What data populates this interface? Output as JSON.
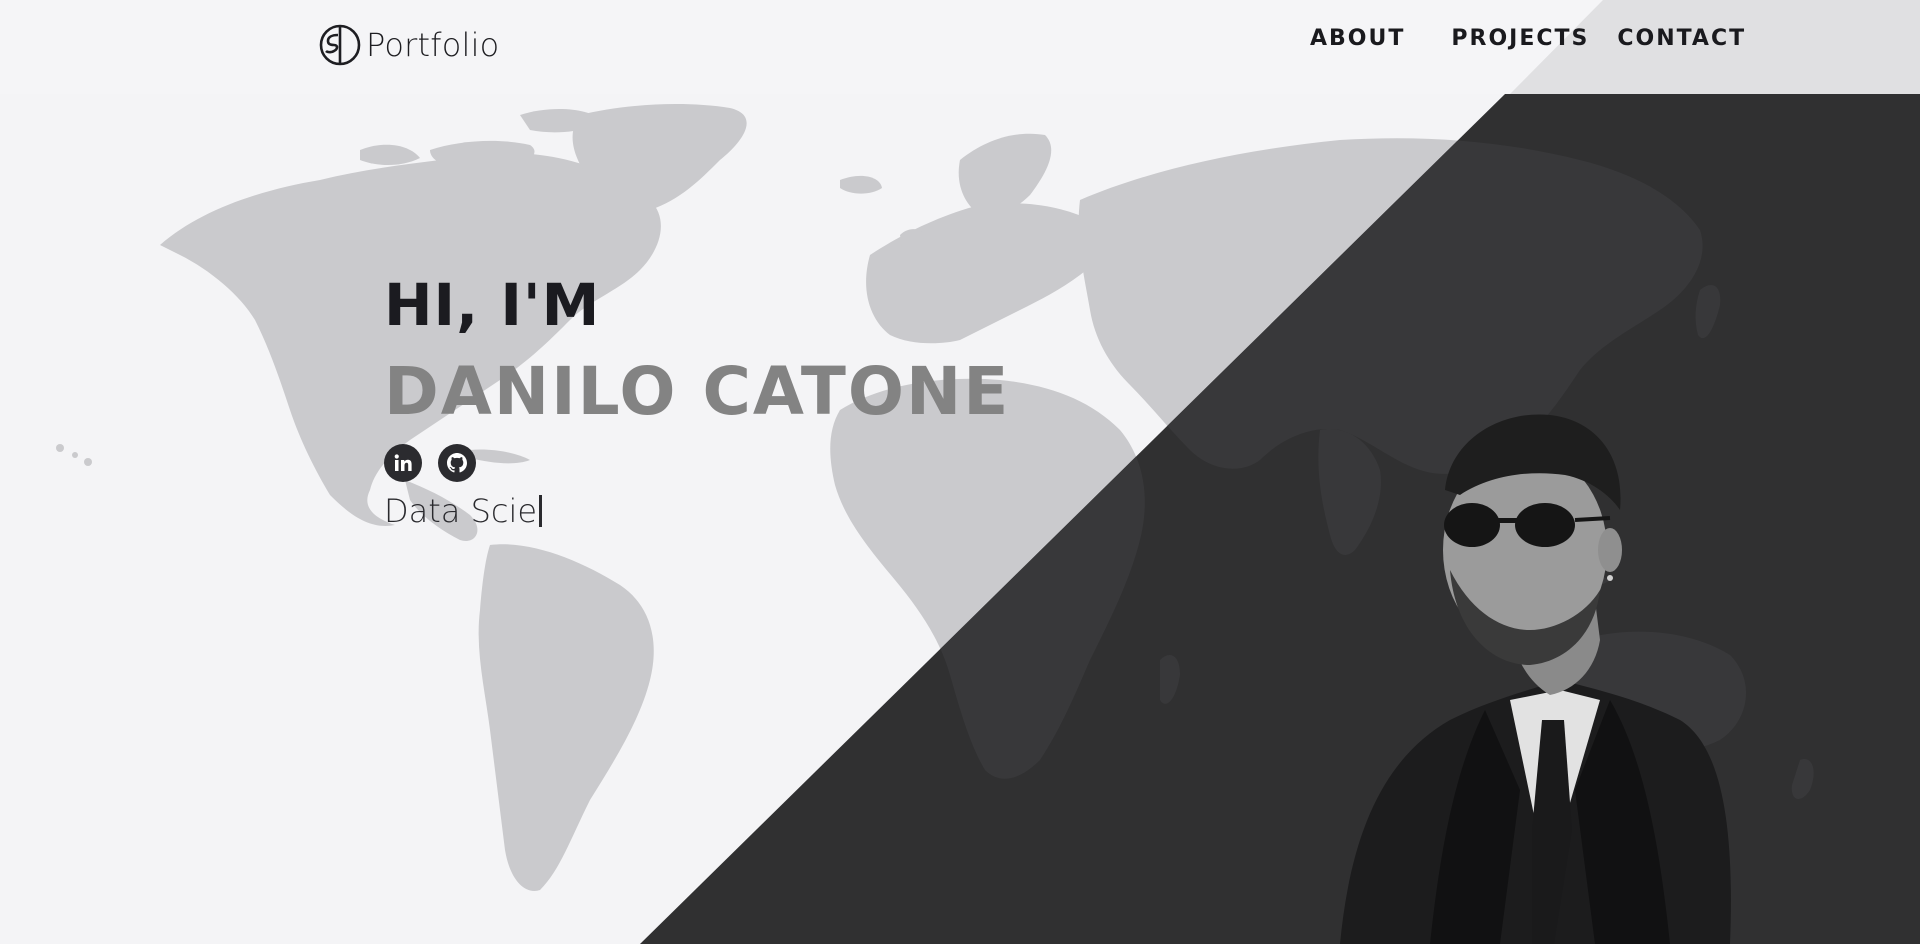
{
  "brand": {
    "logo_text": "Portfolio",
    "logo_icon": "sd-monogram-icon"
  },
  "nav": {
    "items": [
      {
        "label": "ABOUT"
      },
      {
        "label": "PROJECTS"
      },
      {
        "label": "CONTACT"
      }
    ]
  },
  "hero": {
    "greeting": "HI, I'M",
    "name": "DANILO CATONE",
    "typed_text": "Data Scie",
    "socials": [
      {
        "icon": "linkedin-icon"
      },
      {
        "icon": "github-icon"
      }
    ]
  },
  "colors": {
    "background": "#f4f4f6",
    "dark_panel": "#303031",
    "heading": "#1b1b20",
    "name": "#838383",
    "map_light": "#c9c9cc",
    "map_dark": "#3a3a3c"
  }
}
